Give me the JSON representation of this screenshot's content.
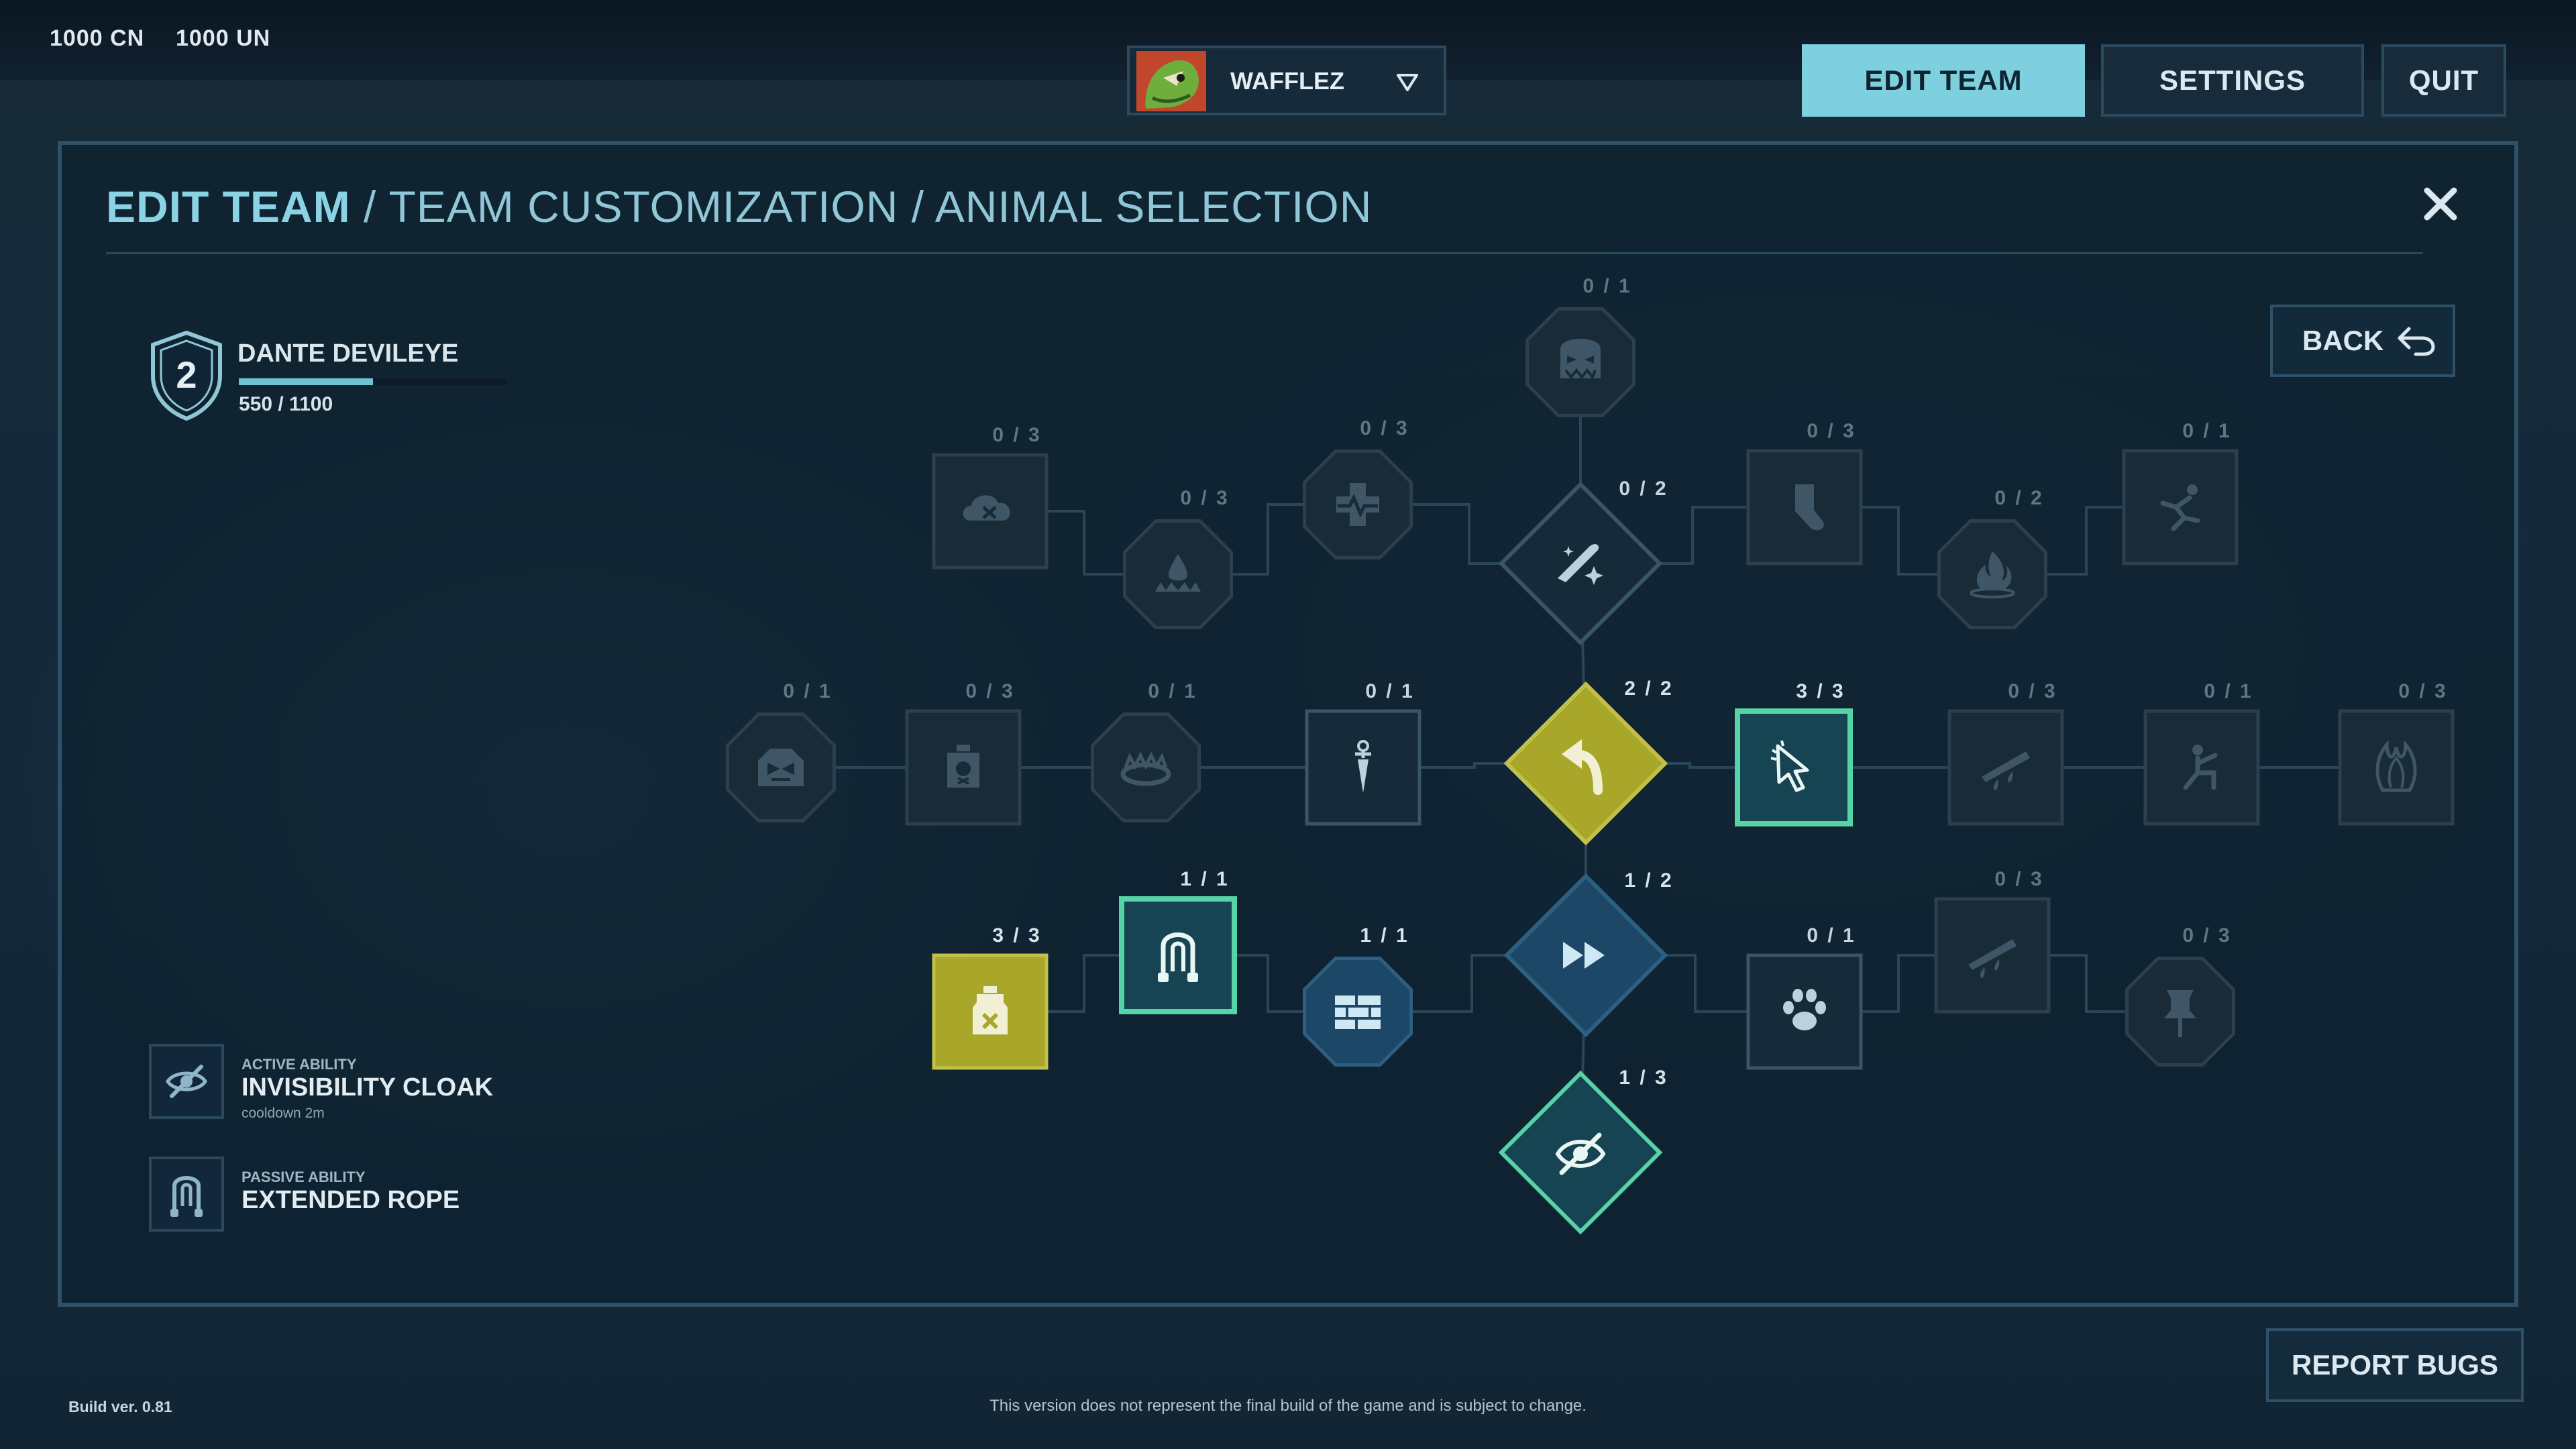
{
  "currencies": [
    {
      "amount": "1000",
      "code": "CN"
    },
    {
      "amount": "1000",
      "code": "UN"
    }
  ],
  "player": {
    "name": "WAFFLEZ"
  },
  "nav": {
    "edit_team": "EDIT TEAM",
    "settings": "SETTINGS",
    "quit": "QUIT"
  },
  "breadcrumb": {
    "section": "EDIT TEAM",
    "rest": " / TEAM CUSTOMIZATION / ANIMAL SELECTION"
  },
  "hero": {
    "level": "2",
    "name": "DANTE DEVILEYE",
    "xp_text": "550 / 1100",
    "xp_fraction": 0.5
  },
  "back_label": "BACK",
  "abilities": {
    "active": {
      "type": "ACTIVE ABILITY",
      "name": "INVISIBILITY CLOAK",
      "sub": "cooldown 2m"
    },
    "passive": {
      "type": "PASSIVE ABILITY",
      "name": "EXTENDED ROPE"
    }
  },
  "skill_nodes": [
    {
      "id": "cloud-x",
      "count": "0/3",
      "state": "locked",
      "icon": "cloud-x-icon"
    },
    {
      "id": "blood-drop-trap",
      "count": "0/3",
      "state": "locked",
      "icon": "blood-drop-trap-icon"
    },
    {
      "id": "heartbeat-cross",
      "count": "0/3",
      "state": "locked",
      "icon": "heartbeat-cross-icon"
    },
    {
      "id": "monster-face",
      "count": "0/1",
      "state": "locked",
      "icon": "monster-face-icon"
    },
    {
      "id": "sparkle-bullet",
      "count": "0/2",
      "state": "available",
      "icon": "sparkle-bullet-icon"
    },
    {
      "id": "sock",
      "count": "0/3",
      "state": "locked",
      "icon": "sock-icon"
    },
    {
      "id": "fire-trap",
      "count": "0/2",
      "state": "locked",
      "icon": "fire-trap-icon"
    },
    {
      "id": "running-figure",
      "count": "0/1",
      "state": "locked",
      "icon": "running-figure-icon"
    },
    {
      "id": "monster-house",
      "count": "0/1",
      "state": "locked",
      "icon": "monster-house-icon"
    },
    {
      "id": "poison-jar",
      "count": "0/3",
      "state": "locked",
      "icon": "poison-jar-icon"
    },
    {
      "id": "bear-trap",
      "count": "0/1",
      "state": "locked",
      "icon": "bear-trap-icon"
    },
    {
      "id": "dagger",
      "count": "0/1",
      "state": "available",
      "icon": "dagger-icon"
    },
    {
      "id": "dodge-arrow",
      "count": "2/2",
      "state": "maxed",
      "icon": "curved-arrow-icon"
    },
    {
      "id": "cursor-click",
      "count": "3/3",
      "state": "selected",
      "icon": "cursor-click-icon"
    },
    {
      "id": "bloody-blade",
      "count": "0/3",
      "state": "locked",
      "icon": "bloody-blade-icon"
    },
    {
      "id": "kneeling-figure",
      "count": "0/1",
      "state": "locked",
      "icon": "kneeling-figure-icon"
    },
    {
      "id": "flame-hands",
      "count": "0/3",
      "state": "locked",
      "icon": "flame-hands-icon"
    },
    {
      "id": "antidote-bottle",
      "count": "3/3",
      "state": "maxed",
      "icon": "antidote-bottle-icon"
    },
    {
      "id": "extended-rope",
      "count": "1/1",
      "state": "selected",
      "icon": "rope-icon"
    },
    {
      "id": "brick-wall",
      "count": "1/1",
      "state": "active",
      "icon": "brick-wall-icon"
    },
    {
      "id": "fast-forward",
      "count": "1/2",
      "state": "active",
      "icon": "fast-forward-icon"
    },
    {
      "id": "paw",
      "count": "0/1",
      "state": "available",
      "icon": "paw-icon"
    },
    {
      "id": "bloody-blade-2",
      "count": "0/3",
      "state": "locked",
      "icon": "bloody-blade-icon"
    },
    {
      "id": "pushpin",
      "count": "0/3",
      "state": "locked",
      "icon": "pushpin-icon"
    },
    {
      "id": "invisibility-eye",
      "count": "1/3",
      "state": "selected",
      "icon": "eye-slash-icon"
    }
  ],
  "colors": {
    "accent": "#7fd0df",
    "maxed": "#a8a72a",
    "selected": "#56d4a8",
    "active": "#1e4a6a",
    "locked": "#1a2b38"
  },
  "report_bugs": "REPORT BUGS",
  "build": "Build ver. 0.81",
  "disclaimer": "This version does not represent the final build of the game and is subject to change."
}
